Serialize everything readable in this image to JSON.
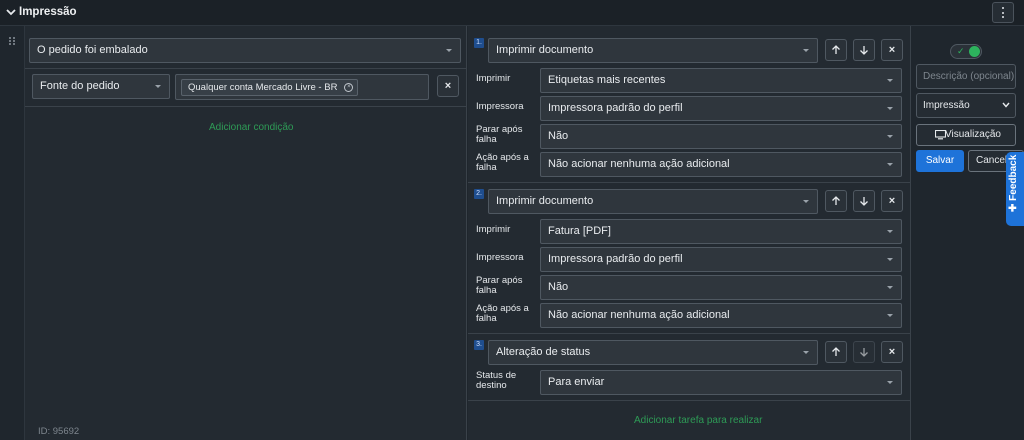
{
  "header": {
    "title": "Impressão"
  },
  "trigger": {
    "event": "O pedido foi embalado"
  },
  "condition": {
    "field": "Fonte do pedido",
    "tag": "Qualquer conta Mercado Livre - BR",
    "remove_label": "×",
    "add_label": "Adicionar condição"
  },
  "meta": {
    "id_label": "ID: 95692"
  },
  "tasks": [
    {
      "number": "1.",
      "type": "Imprimir documento",
      "fields": [
        {
          "label": "Imprimir",
          "value": "Etiquetas mais recentes"
        },
        {
          "label": "Impressora",
          "value": "Impressora padrão do perfil"
        },
        {
          "label": "Parar após falha",
          "value": "Não"
        },
        {
          "label": "Ação após a falha",
          "value": "Não acionar nenhuma ação adicional"
        }
      ]
    },
    {
      "number": "2.",
      "type": "Imprimir documento",
      "fields": [
        {
          "label": "Imprimir",
          "value": "Fatura [PDF]"
        },
        {
          "label": "Impressora",
          "value": "Impressora padrão do perfil"
        },
        {
          "label": "Parar após falha",
          "value": "Não"
        },
        {
          "label": "Ação após a falha",
          "value": "Não acionar nenhuma ação adicional"
        }
      ]
    },
    {
      "number": "3.",
      "type": "Alteração de status",
      "fields": [
        {
          "label": "Status de destino",
          "value": "Para enviar"
        }
      ]
    }
  ],
  "add_task_label": "Adicionar tarefa para realizar",
  "sidebar": {
    "enabled": true,
    "description_placeholder": "Descrição (opcional)",
    "category": "Impressão",
    "preview_label": "Visualização",
    "save_label": "Salvar",
    "cancel_label": "Cancelar"
  },
  "feedback_label": "✚ Feedback",
  "colors": {
    "accent_green": "#2db35d",
    "primary_blue": "#1e73d9",
    "link_green": "#2e9b56"
  },
  "icons": [
    "chevron-down-icon",
    "kebab-menu-icon",
    "drag-handle-icon",
    "arrow-up-icon",
    "arrow-down-icon",
    "close-icon",
    "monitor-icon",
    "check-icon"
  ]
}
